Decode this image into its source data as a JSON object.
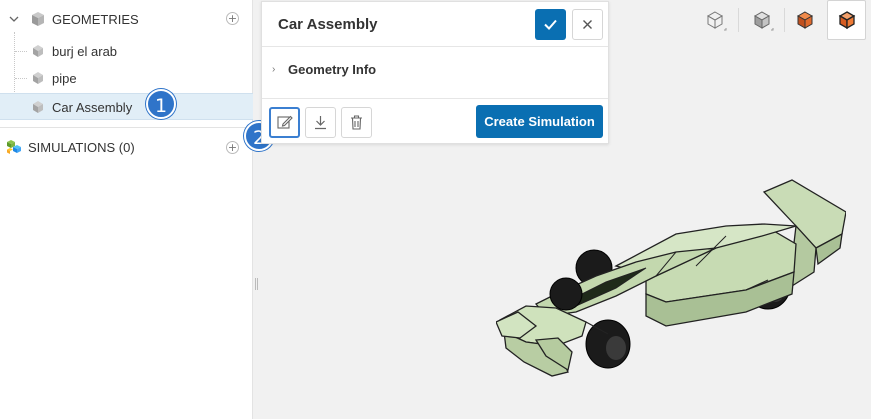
{
  "tree": {
    "geometries_label": "GEOMETRIES",
    "geometries": [
      {
        "label": "burj el arab"
      },
      {
        "label": "pipe"
      },
      {
        "label": "Car Assembly"
      }
    ],
    "simulations_label": "SIMULATIONS (0)",
    "add_symbol": "+"
  },
  "callouts": {
    "one": "1",
    "two": "2"
  },
  "card": {
    "title": "Car Assembly",
    "section": "Geometry Info",
    "create_label": "Create Simulation"
  },
  "view_toolbar": {
    "buttons": [
      "wireframe-view-icon",
      "solid-view-icon",
      "orange-cube-view-icon",
      "orange-cube-outline-view-icon"
    ]
  },
  "colors": {
    "primary": "#0a6fb2",
    "callout": "#2f74c9",
    "selected_row": "#e1eef7",
    "car_body": "#c9dcb6",
    "viewport": "#f1f1f1"
  }
}
